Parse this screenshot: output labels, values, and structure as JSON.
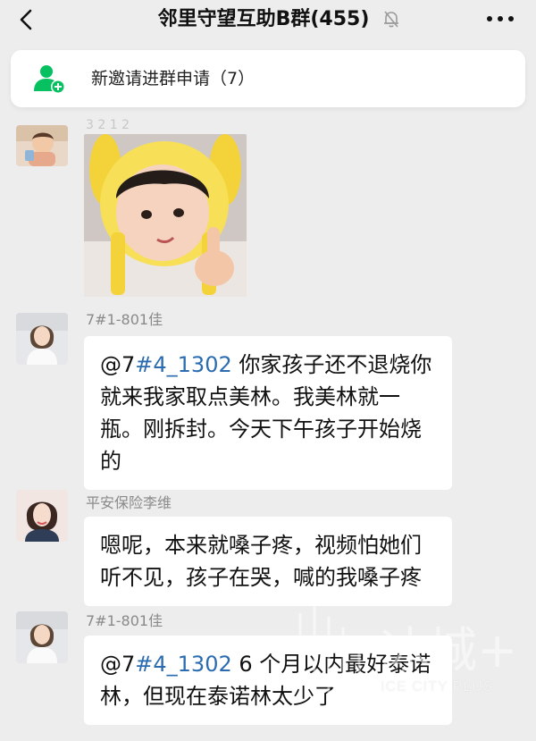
{
  "header": {
    "title": "邻里守望互助B群(455)",
    "back_icon": "chevron-left-icon",
    "mute_icon": "bell-off-icon",
    "more_icon": "more-dots-icon"
  },
  "notice": {
    "icon": "add-contact-icon",
    "text": "新邀请进群申请（7）",
    "accent": "#07c160"
  },
  "messages": [
    {
      "type": "sticker",
      "sender_name_partial": "3 2 1 2"
    },
    {
      "type": "text",
      "sender": "7#1-801佳",
      "mention_prefix": "@7",
      "mention": "#4_1302",
      "body_line1": " 你家孩子还不退烧你",
      "body_line2": "就来我家取点美林。我美林就一",
      "body_line3": "瓶。刚拆封。今天下午孩子开始烧",
      "body_line4": "的"
    },
    {
      "type": "text",
      "sender": "平安保险李维",
      "body_line1": "嗯呢，本来就嗓子疼，视频怕她们",
      "body_line2": "听不见，孩子在哭，喊的我嗓子疼"
    },
    {
      "type": "text",
      "sender": "7#1-801佳",
      "mention_prefix": "@7",
      "mention": "#4_1302",
      "body_line1": " 6 个月以内最好泰诺",
      "body_line2": "林，但现在泰诺林太少了"
    }
  ],
  "watermark": {
    "brand": "冰城+",
    "english": "ICE CITY PLUS"
  }
}
